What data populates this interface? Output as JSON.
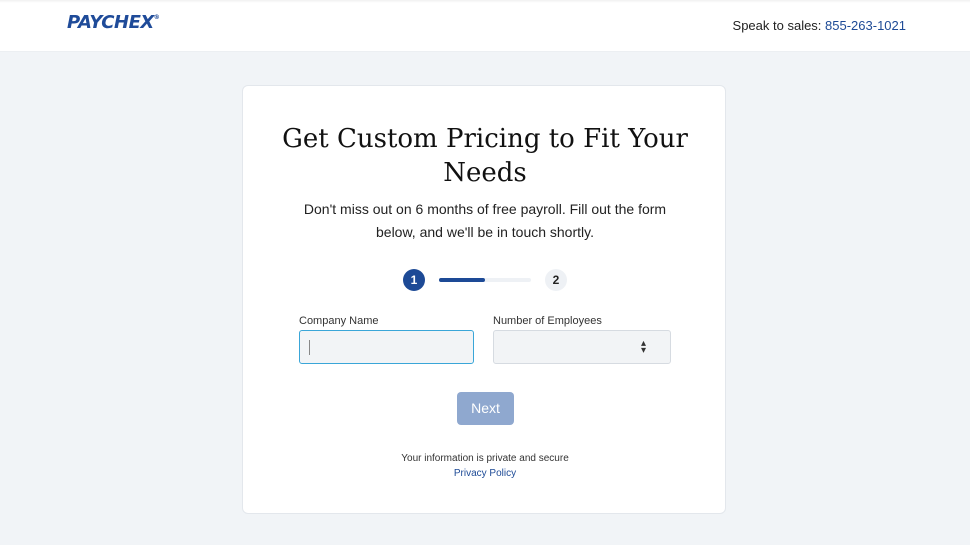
{
  "header": {
    "logo_text": "PAYCHEX",
    "logo_mark": "®",
    "sales_label": "Speak to sales: ",
    "sales_phone": "855-263-1021"
  },
  "card": {
    "title": "Get Custom Pricing to Fit Your Needs",
    "subtitle": "Don't miss out on 6 months of free payroll. Fill out the form below, and we'll be in touch shortly.",
    "steps": {
      "current": "1",
      "next": "2",
      "progress_fraction": 0.5
    },
    "form": {
      "company_label": "Company Name",
      "company_value": "",
      "employees_label": "Number of Employees",
      "employees_value": ""
    },
    "next_button": "Next",
    "private_note": "Your information is private and secure",
    "privacy_link": "Privacy Policy"
  },
  "colors": {
    "brand": "#1d4a96",
    "button_disabled": "#8fa8cf",
    "focus": "#3aa6d8",
    "page_bg": "#f1f4f7"
  }
}
